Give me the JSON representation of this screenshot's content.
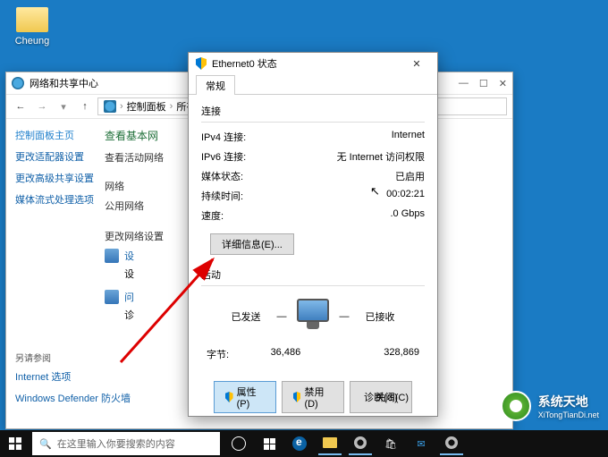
{
  "desktop": {
    "icon_label": "Cheung"
  },
  "cpwin": {
    "title": "网络和共享中心",
    "breadcrumb": {
      "root": "控制面板",
      "mid": "所有控制面板"
    },
    "sidebar": {
      "items": [
        "控制面板主页",
        "更改适配器设置",
        "更改高级共享设置",
        "媒体流式处理选项"
      ],
      "seealso_label": "另请参阅",
      "seealso": [
        "Internet 选项",
        "Windows Defender 防火墙"
      ]
    },
    "main": {
      "heading": "查看基本网",
      "sub": "查看活动网络",
      "net_label": "网络",
      "net_type": "公用网络",
      "change_heading": "更改网络设置",
      "item1_a": "设",
      "item1_b": "设",
      "item2_a": "问",
      "item2_b": "诊"
    }
  },
  "dialog": {
    "title": "Ethernet0 状态",
    "tab": "常规",
    "section_conn": "连接",
    "rows": {
      "ipv4_label": "IPv4 连接:",
      "ipv4_value": "Internet",
      "ipv6_label": "IPv6 连接:",
      "ipv6_value": "无 Internet 访问权限",
      "media_label": "媒体状态:",
      "media_value": "已启用",
      "duration_label": "持续时间:",
      "duration_value": "00:02:21",
      "speed_label": "速度:",
      "speed_value": ".0 Gbps"
    },
    "details_btn": "详细信息(E)...",
    "section_activity": "活动",
    "sent_label": "已发送",
    "recv_label": "已接收",
    "bytes_label": "字节:",
    "sent_bytes": "36,486",
    "recv_bytes": "328,869",
    "btn_props": "属性(P)",
    "btn_disable": "禁用(D)",
    "btn_diag": "诊断(G)",
    "btn_close": "关闭(C)"
  },
  "watermark": {
    "name": "系统天地",
    "url": "XiTongTianDi.net"
  },
  "taskbar": {
    "search_placeholder": "在这里输入你要搜索的内容"
  }
}
